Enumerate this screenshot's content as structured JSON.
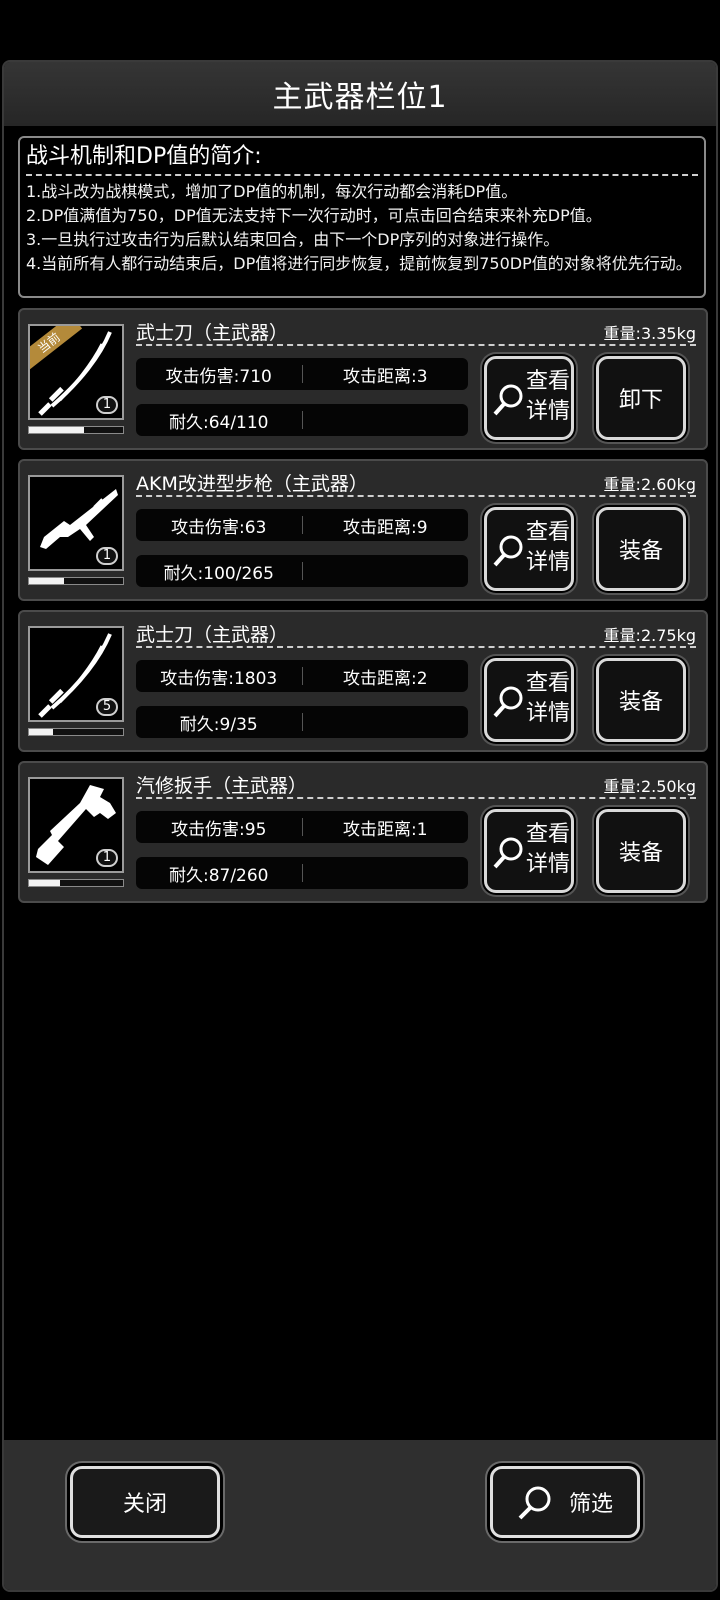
{
  "title": "主武器栏位1",
  "intro": {
    "heading": "战斗机制和DP值的简介:",
    "lines": [
      "1.战斗改为战棋模式，增加了DP值的机制，每次行动都会消耗DP值。",
      "2.DP值满值为750，DP值无法支持下一次行动时，可点击回合结束来补充DP值。",
      "3.一旦执行过攻击行为后默认结束回合，由下一个DP序列的对象进行操作。",
      "4.当前所有人都行动结束后，DP值将进行同步恢复，提前恢复到750DP值的对象将优先行动。"
    ]
  },
  "weapons": [
    {
      "name": "武士刀（主武器）",
      "weight": "重量:3.35kg",
      "damage": "攻击伤害:710",
      "range": "攻击距离:3",
      "durability": "耐久:64/110",
      "durability_value": 64,
      "durability_max": 110,
      "level": "1",
      "current_tag": "当前",
      "detail_label": "查看详情",
      "action_label": "卸下",
      "icon": "katana-icon"
    },
    {
      "name": "AKM改进型步枪（主武器）",
      "weight": "重量:2.60kg",
      "damage": "攻击伤害:63",
      "range": "攻击距离:9",
      "durability": "耐久:100/265",
      "durability_value": 100,
      "durability_max": 265,
      "level": "1",
      "detail_label": "查看详情",
      "action_label": "装备",
      "icon": "rifle-icon"
    },
    {
      "name": "武士刀（主武器）",
      "weight": "重量:2.75kg",
      "damage": "攻击伤害:1803",
      "range": "攻击距离:2",
      "durability": "耐久:9/35",
      "durability_value": 9,
      "durability_max": 35,
      "level": "5",
      "detail_label": "查看详情",
      "action_label": "装备",
      "icon": "katana-icon"
    },
    {
      "name": "汽修扳手（主武器）",
      "weight": "重量:2.50kg",
      "damage": "攻击伤害:95",
      "range": "攻击距离:1",
      "durability": "耐久:87/260",
      "durability_value": 87,
      "durability_max": 260,
      "level": "1",
      "detail_label": "查看详情",
      "action_label": "装备",
      "icon": "wrench-icon"
    }
  ],
  "footer": {
    "close_label": "关闭",
    "filter_label": "筛选"
  }
}
